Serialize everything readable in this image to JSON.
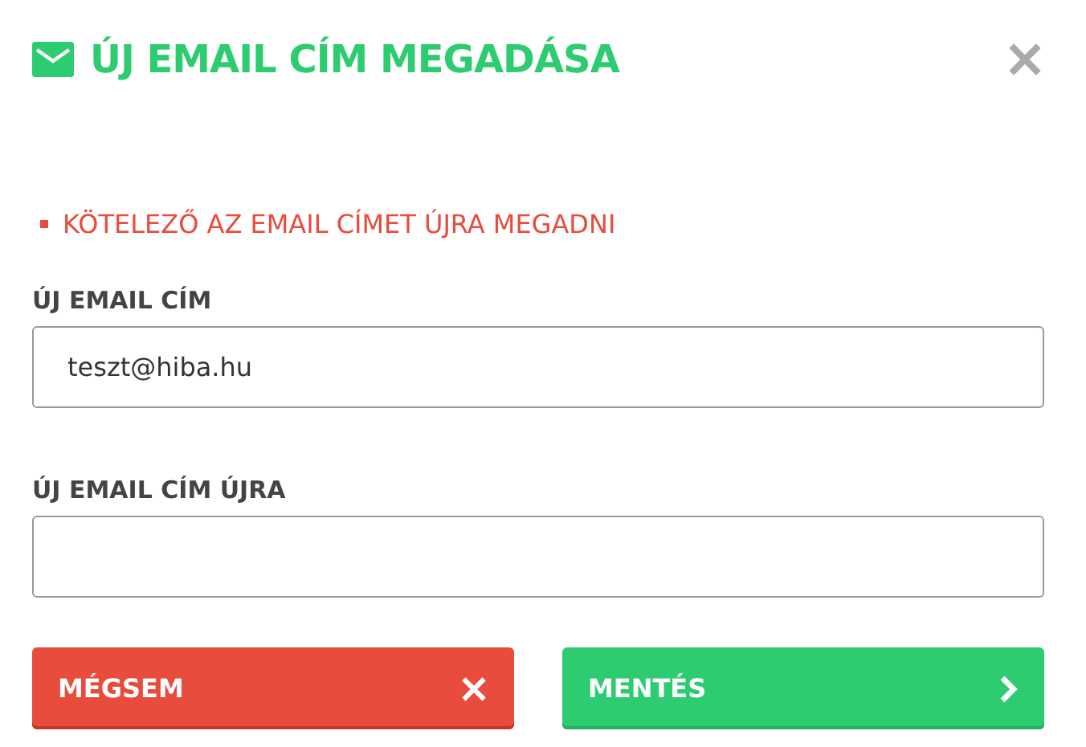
{
  "dialog": {
    "title": "ÚJ EMAIL CÍM MEGADÁSA"
  },
  "errors": [
    "KÖTELEZŐ AZ EMAIL CÍMET ÚJRA MEGADNI"
  ],
  "fields": [
    {
      "label": "ÚJ EMAIL CÍM",
      "value": "teszt@hiba.hu"
    },
    {
      "label": "ÚJ EMAIL CÍM ÚJRA"
    }
  ],
  "buttons": [
    {
      "label": "MÉGSEM",
      "kind": "cancel"
    },
    {
      "label": "MENTÉS",
      "kind": "save"
    }
  ]
}
